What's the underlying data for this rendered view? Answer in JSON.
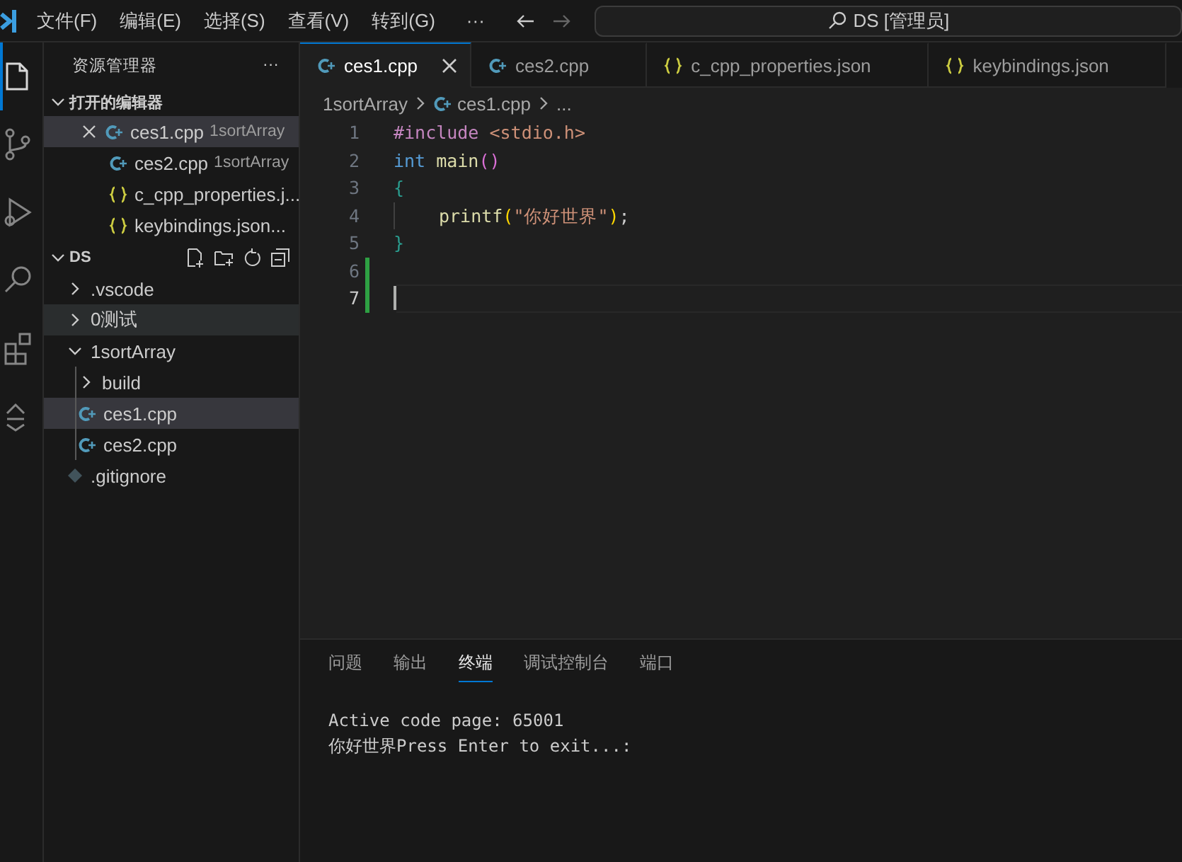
{
  "title_bar": {
    "menus": [
      "文件(F)",
      "编辑(E)",
      "选择(S)",
      "查看(V)",
      "转到(G)"
    ],
    "more": "···",
    "search": "DS [管理员]"
  },
  "activity_bar": {
    "items": [
      {
        "kind": "files",
        "selected": true
      },
      {
        "kind": "source-control",
        "selected": false
      },
      {
        "kind": "run",
        "selected": false
      },
      {
        "kind": "search",
        "selected": false
      },
      {
        "kind": "extensions",
        "selected": false
      },
      {
        "kind": "remote",
        "selected": false
      }
    ]
  },
  "sidebar": {
    "title": "资源管理器",
    "more": "···",
    "open_editors": {
      "title": "打开的编辑器",
      "expanded": true,
      "items": [
        {
          "label": "ces1.cpp",
          "description": "1sortArray",
          "kind": "cpp",
          "selected": true
        },
        {
          "label": "ces2.cpp",
          "description": "1sortArray",
          "kind": "cpp",
          "selected": false
        },
        {
          "label": "c_cpp_properties.j...",
          "kind": "json",
          "selected": false
        },
        {
          "label": "keybindings.json...",
          "kind": "json",
          "selected": false
        }
      ]
    },
    "folder": {
      "title": "DS",
      "expanded": true,
      "items": [
        {
          "label": ".vscode",
          "kind": "folder",
          "expanded": false,
          "selected": false,
          "hovered": false
        },
        {
          "label": "0测试",
          "kind": "folder",
          "expanded": false,
          "selected": false,
          "hovered": true
        },
        {
          "label": "1sortArray",
          "kind": "folder",
          "expanded": true,
          "selected": false,
          "hovered": false,
          "children": [
            {
              "label": "build",
              "kind": "folder",
              "expanded": false,
              "selected": false,
              "hovered": false
            },
            {
              "label": "ces1.cpp",
              "kind": "cpp",
              "selected": true,
              "hovered": false
            },
            {
              "label": "ces2.cpp",
              "kind": "cpp",
              "selected": false,
              "hovered": false
            }
          ]
        },
        {
          "label": ".gitignore",
          "kind": "git",
          "selected": false,
          "hovered": false
        }
      ]
    }
  },
  "tabs": [
    {
      "label": "ces1.cpp",
      "kind": "cpp",
      "selected": true
    },
    {
      "label": "ces2.cpp",
      "kind": "cpp",
      "selected": false
    },
    {
      "label": "c_cpp_properties.json",
      "kind": "json",
      "selected": false
    },
    {
      "label": "keybindings.json",
      "kind": "json",
      "selected": false
    }
  ],
  "breadcrumbs": [
    {
      "label": "1sortArray",
      "kind": "folder"
    },
    {
      "label": "ces1.cpp",
      "kind": "cpp"
    },
    {
      "label": "...",
      "kind": "more"
    }
  ],
  "editor": {
    "lines": [
      {
        "number": "1",
        "added": false,
        "current": false,
        "tokens": [
          {
            "kind": "preproc",
            "text": "#include"
          },
          {
            "kind": "string",
            "text": " <stdio.h>"
          }
        ]
      },
      {
        "number": "2",
        "added": false,
        "current": false,
        "tokens": [
          {
            "kind": "keyword",
            "text": "int"
          },
          {
            "kind": "function",
            "text": " main"
          },
          {
            "kind": "paren",
            "text": "()"
          }
        ]
      },
      {
        "number": "3",
        "added": false,
        "current": false,
        "tokens": [
          {
            "kind": "brace",
            "text": "{"
          }
        ]
      },
      {
        "number": "4",
        "added": false,
        "current": false,
        "indented": true,
        "tokens": [
          {
            "kind": "function",
            "text": "printf"
          },
          {
            "kind": "paren2",
            "text": "("
          },
          {
            "kind": "string",
            "text": "\"你好世界\""
          },
          {
            "kind": "paren2",
            "text": ")"
          },
          {
            "kind": "plain",
            "text": ";"
          }
        ]
      },
      {
        "number": "5",
        "added": false,
        "current": false,
        "tokens": [
          {
            "kind": "brace",
            "text": "}"
          }
        ]
      },
      {
        "number": "6",
        "added": true,
        "current": false
      },
      {
        "number": "7",
        "added": true,
        "current": true
      }
    ]
  },
  "panel": {
    "tabs": [
      {
        "label": "问题",
        "selected": false
      },
      {
        "label": "输出",
        "selected": false
      },
      {
        "label": "终端",
        "selected": true
      },
      {
        "label": "调试控制台",
        "selected": false
      },
      {
        "label": "端口",
        "selected": false
      }
    ],
    "terminal": [
      "Active code page: 65001",
      "你好世界Press Enter to exit...:"
    ]
  }
}
